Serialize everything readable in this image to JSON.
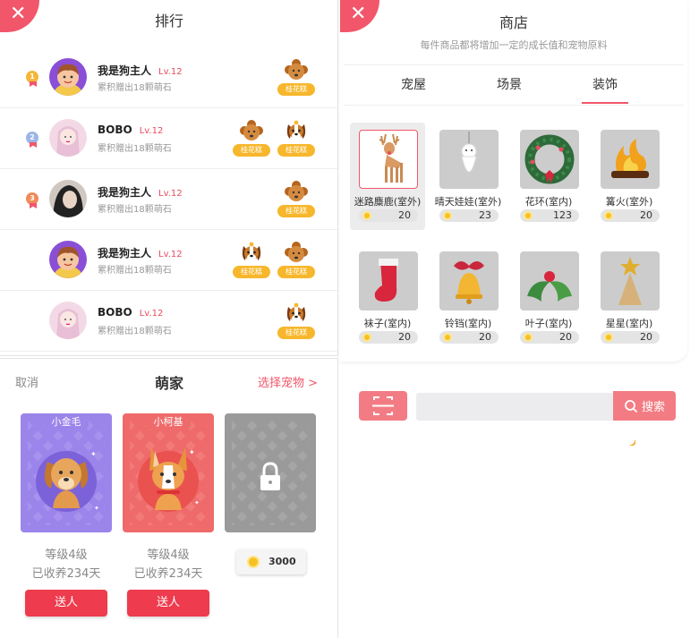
{
  "ranking": {
    "title": "排行",
    "close_icon": "close-icon",
    "rows": [
      {
        "rank": "1",
        "medal_color": "#f4b63a",
        "name": "我是狗主人",
        "level": "Lv.12",
        "sub": "累积赠出18颗萌石",
        "avatar": "boy",
        "pets": [
          {
            "kind": "poodle",
            "tag": "桂花糕"
          }
        ]
      },
      {
        "rank": "2",
        "medal_color": "#9bb5e6",
        "name": "BOBO",
        "level": "Lv.12",
        "sub": "累积赠出18颗萌石",
        "avatar": "girl",
        "pets": [
          {
            "kind": "poodle",
            "tag": "桂花糕"
          },
          {
            "kind": "beagle",
            "tag": "桂花糕"
          }
        ]
      },
      {
        "rank": "3",
        "medal_color": "#f08a5a",
        "name": "我是狗主人",
        "level": "Lv.12",
        "sub": "累积赠出18颗萌石",
        "avatar": "photo",
        "pets": [
          {
            "kind": "poodle",
            "tag": "桂花糕"
          }
        ]
      },
      {
        "rank": "",
        "medal_color": "",
        "name": "我是狗主人",
        "level": "Lv.12",
        "sub": "累积赠出18颗萌石",
        "avatar": "boy",
        "pets": [
          {
            "kind": "beagle",
            "tag": "桂花糕"
          },
          {
            "kind": "poodle",
            "tag": "桂花糕"
          }
        ]
      },
      {
        "rank": "",
        "medal_color": "",
        "name": "BOBO",
        "level": "Lv.12",
        "sub": "累积赠出18颗萌石",
        "avatar": "girl",
        "pets": [
          {
            "kind": "beagle",
            "tag": "桂花糕"
          }
        ]
      }
    ]
  },
  "shop": {
    "title": "商店",
    "subtitle": "每件商品都将增加一定的成长值和宠物原料",
    "tabs": [
      {
        "label": "宠屋",
        "active": false
      },
      {
        "label": "场景",
        "active": false
      },
      {
        "label": "装饰",
        "active": true
      }
    ],
    "items": [
      {
        "name": "迷路麋鹿(室外)",
        "price": "20",
        "icon": "reindeer-icon",
        "selected": true
      },
      {
        "name": "晴天娃娃(室外)",
        "price": "23",
        "icon": "teru-teru-bozu-icon",
        "selected": false
      },
      {
        "name": "花环(室内)",
        "price": "123",
        "icon": "wreath-icon",
        "selected": false
      },
      {
        "name": "篝火(室外)",
        "price": "20",
        "icon": "bonfire-icon",
        "selected": false
      },
      {
        "name": "袜子(室内)",
        "price": "20",
        "icon": "stocking-icon",
        "selected": false
      },
      {
        "name": "铃铛(室内)",
        "price": "20",
        "icon": "bell-icon",
        "selected": false
      },
      {
        "name": "叶子(室内)",
        "price": "20",
        "icon": "holly-leaf-icon",
        "selected": false
      },
      {
        "name": "星星(室内)",
        "price": "20",
        "icon": "star-tree-icon",
        "selected": false
      }
    ],
    "search": {
      "button_label": "搜索",
      "placeholder": "",
      "scan_icon": "scan-icon"
    }
  },
  "home": {
    "cancel": "取消",
    "title": "萌家",
    "pick": "选择宠物 >",
    "cards": [
      {
        "name": "小金毛",
        "level": "等级4级",
        "days": "已收养234天",
        "gift": "送人",
        "color": "#9b84ea",
        "pet": "golden"
      },
      {
        "name": "小柯基",
        "level": "等级4级",
        "days": "已收养234天",
        "gift": "送人",
        "color": "#ef6a6a",
        "pet": "corgi"
      },
      {
        "name": "",
        "locked": true,
        "price": "3000",
        "color": "#9a9a9a",
        "pet": "lock"
      }
    ]
  },
  "colors": {
    "accent": "#f2566b",
    "button": "#ee3b4d",
    "coin": "#f7c122",
    "tag": "#f7b72c"
  }
}
